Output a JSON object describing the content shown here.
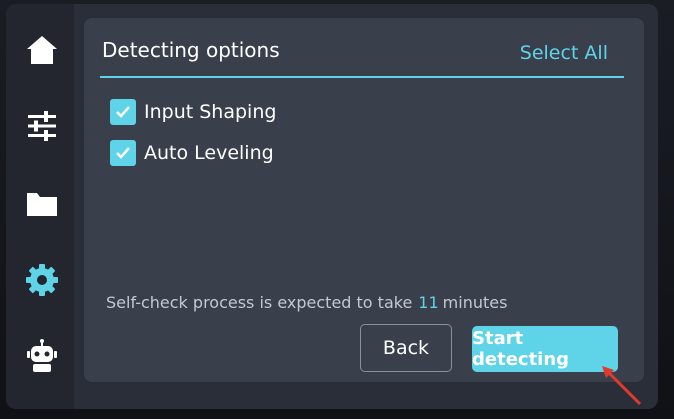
{
  "colors": {
    "accent": "#5fd4e8",
    "panel": "#3a3f4c",
    "sidebar": "#23262e"
  },
  "sidebar": {
    "items": [
      {
        "icon": "home-icon"
      },
      {
        "icon": "sliders-icon"
      },
      {
        "icon": "folder-icon"
      },
      {
        "icon": "gear-icon",
        "active": true
      },
      {
        "icon": "robot-icon"
      }
    ]
  },
  "panel": {
    "title": "Detecting options",
    "select_all_label": "Select All",
    "options": [
      {
        "label": "Input Shaping",
        "checked": true
      },
      {
        "label": "Auto Leveling",
        "checked": true
      }
    ],
    "info_prefix": "Self-check process is expected to take",
    "info_value": "11",
    "info_suffix": "minutes"
  },
  "buttons": {
    "back_label": "Back",
    "start_label": "Start detecting"
  }
}
